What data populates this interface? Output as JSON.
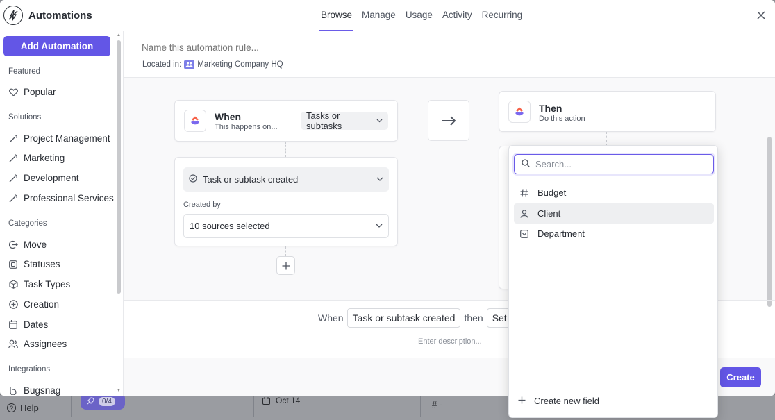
{
  "header": {
    "title": "Automations",
    "tabs": [
      {
        "label": "Browse",
        "active": true
      },
      {
        "label": "Manage",
        "active": false
      },
      {
        "label": "Usage",
        "active": false
      },
      {
        "label": "Activity",
        "active": false
      },
      {
        "label": "Recurring",
        "active": false
      }
    ],
    "close_icon": "x-icon"
  },
  "sidebar": {
    "add_button": "Add Automation",
    "sections": {
      "featured": "Featured",
      "solutions": "Solutions",
      "categories": "Categories",
      "integrations": "Integrations"
    },
    "featured_items": [
      {
        "label": "Popular",
        "icon": "heart-icon"
      }
    ],
    "solution_items": [
      {
        "label": "Project Management",
        "icon": "magic-wand-icon"
      },
      {
        "label": "Marketing",
        "icon": "magic-wand-icon"
      },
      {
        "label": "Development",
        "icon": "magic-wand-icon"
      },
      {
        "label": "Professional Services",
        "icon": "magic-wand-icon"
      }
    ],
    "category_items": [
      {
        "label": "Move",
        "icon": "move-icon"
      },
      {
        "label": "Statuses",
        "icon": "status-icon"
      },
      {
        "label": "Task Types",
        "icon": "cube-icon"
      },
      {
        "label": "Creation",
        "icon": "plus-circle-icon"
      },
      {
        "label": "Dates",
        "icon": "calendar-icon"
      },
      {
        "label": "Assignees",
        "icon": "people-icon"
      }
    ],
    "integration_items": [
      {
        "label": "Bugsnag",
        "icon": "bugsnag-icon"
      }
    ]
  },
  "rule": {
    "name_placeholder": "Name this automation rule...",
    "located_label": "Located in:",
    "location": "Marketing Company HQ"
  },
  "when_card": {
    "title": "When",
    "subtitle": "This happens on...",
    "scope": "Tasks or subtasks",
    "trigger": "Task or subtask created",
    "created_by_label": "Created by",
    "created_by_value": "10 sources selected"
  },
  "then_card": {
    "title": "Then",
    "subtitle": "Do this action"
  },
  "summary": {
    "when_word": "When",
    "trigger": "Task or subtask created",
    "then_word": "then",
    "action": "Set",
    "description_placeholder": "Enter description..."
  },
  "footer": {
    "create_button": "Create"
  },
  "dropdown": {
    "search_placeholder": "Search...",
    "options": [
      {
        "label": "Budget",
        "icon": "hash-icon"
      },
      {
        "label": "Client",
        "icon": "person-icon"
      },
      {
        "label": "Department",
        "icon": "dropdown-field-icon"
      }
    ],
    "create_new": "Create new field"
  },
  "background": {
    "help": "Help",
    "pill_count": "0/4",
    "date": "Oct 14",
    "hash_value": "-"
  },
  "colors": {
    "accent": "#6356e6",
    "tab_underline": "#6a5be8"
  }
}
